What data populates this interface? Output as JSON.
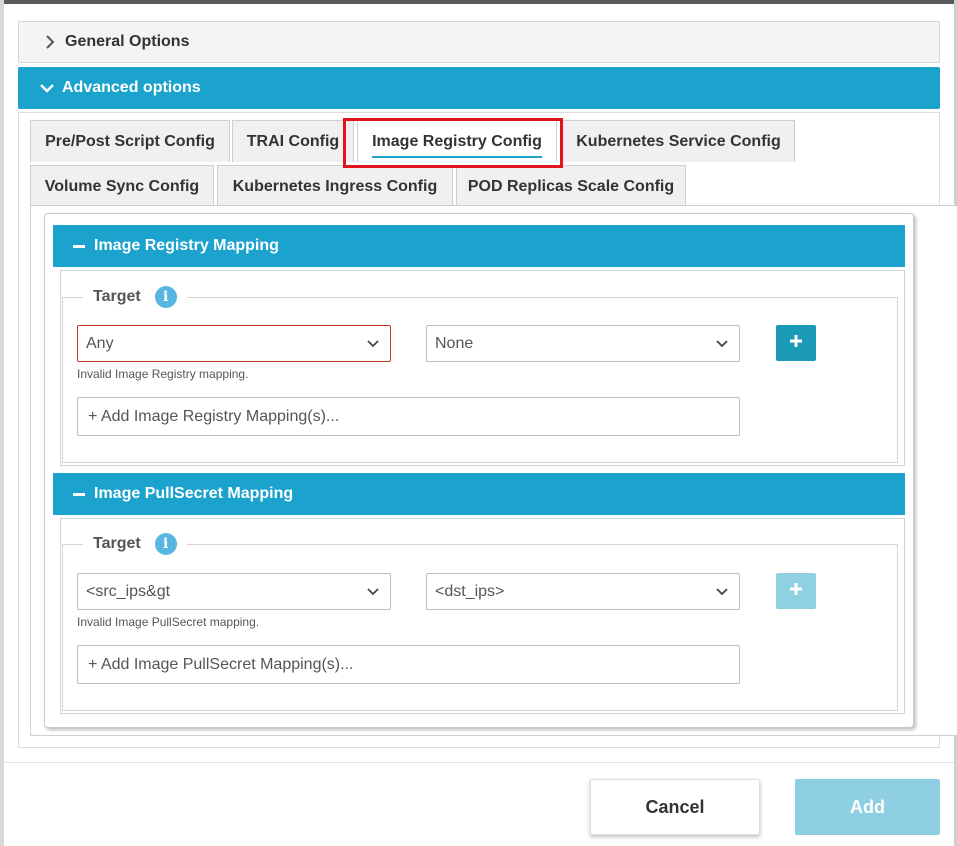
{
  "accordion": {
    "general_label": "General Options",
    "advanced_label": "Advanced options"
  },
  "tabs": {
    "row1": [
      "Pre/Post Script Config",
      "TRAI Config",
      "Image Registry Config",
      "Kubernetes Service Config"
    ],
    "row2": [
      "Volume Sync Config",
      "Kubernetes Ingress Config",
      "POD Replicas Scale Config"
    ],
    "active": "Image Registry Config"
  },
  "registry": {
    "title": "Image Registry Mapping",
    "legend": "Target",
    "source_value": "Any",
    "target_value": "None",
    "error": "Invalid Image Registry mapping.",
    "add_placeholder": "+ Add Image Registry Mapping(s)..."
  },
  "pullsecret": {
    "title": "Image PullSecret Mapping",
    "legend": "Target",
    "source_value": "<src_ips&gt",
    "target_value": "<dst_ips>",
    "error": "Invalid Image PullSecret mapping.",
    "add_placeholder": "+ Add Image PullSecret Mapping(s)..."
  },
  "footer": {
    "cancel_label": "Cancel",
    "add_label": "Add"
  },
  "colors": {
    "accent": "#1ba2cd",
    "highlight": "#e0141e",
    "add_disabled": "#8fcfe3"
  }
}
